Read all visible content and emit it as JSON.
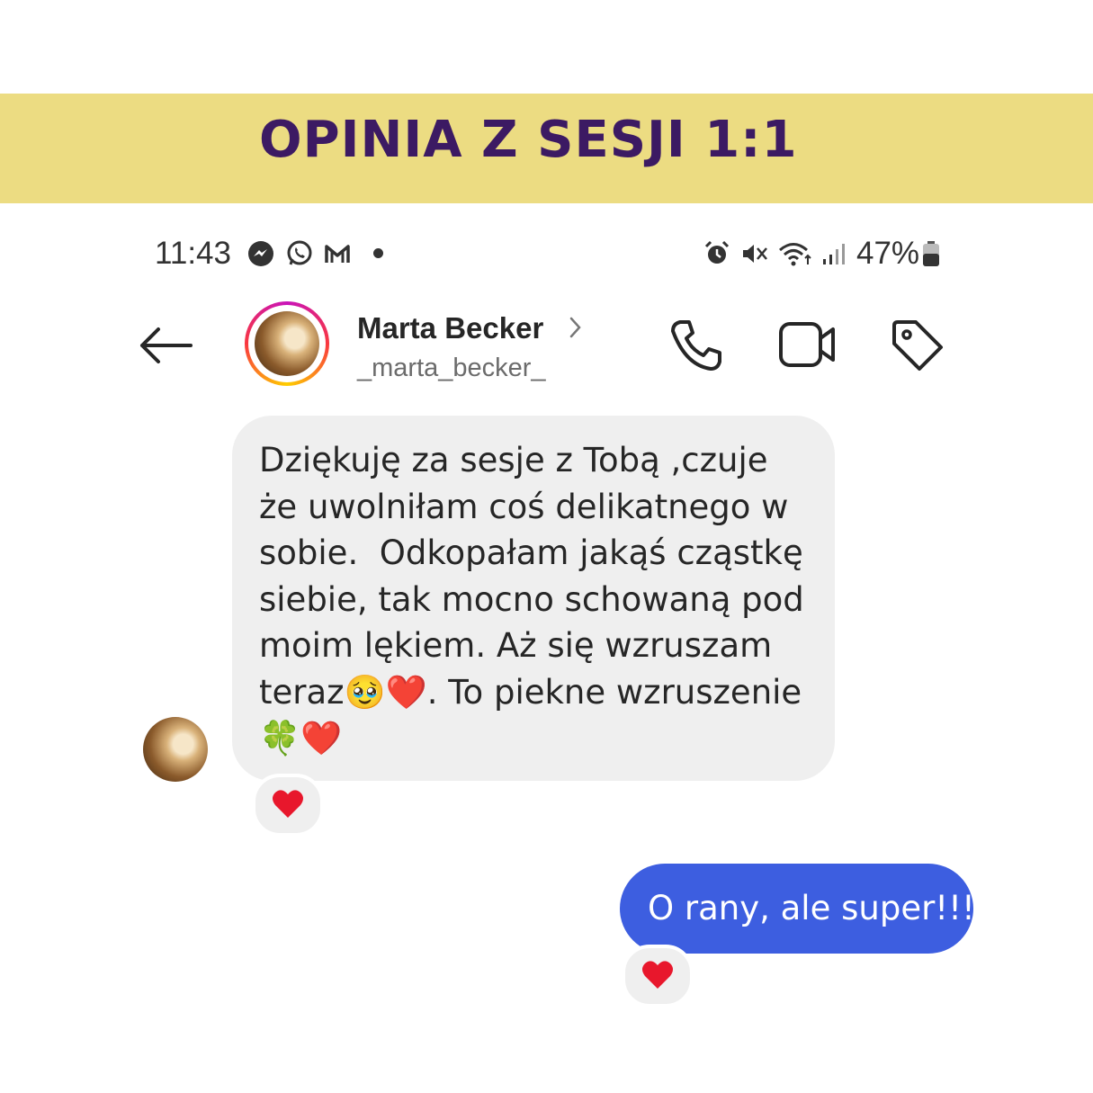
{
  "banner": {
    "title": "OPINIA Z SESJI 1:1"
  },
  "status_bar": {
    "time": "11:43",
    "left_icons": [
      "messenger-icon",
      "whatsapp-icon",
      "gmail-icon"
    ],
    "right_icons": [
      "alarm-icon",
      "mute-icon",
      "wifi-icon",
      "signal-icon",
      "battery-icon"
    ],
    "battery": "47%"
  },
  "header": {
    "name": "Marta Becker",
    "username": "_marta_becker_",
    "actions": [
      "back-arrow-icon",
      "phone-icon",
      "video-camera-icon",
      "tag-icon"
    ]
  },
  "messages": [
    {
      "direction": "incoming",
      "text": "Dziękuję za sesje z Tobą ,czuje\nże uwolniłam coś delikatnego w\nsobie.  Odkopałam jakąś cząstkę\nsiebie, tak mocno schowaną pod\nmoim lękiem. Aż się wzruszam\nteraz🥹❤️. To piekne wzruszenie\n🍀❤️",
      "reaction": "❤️"
    },
    {
      "direction": "outgoing",
      "text": "O rany, ale super!!!",
      "reaction": "❤️"
    }
  ],
  "colors": {
    "banner_bg": "#ecdc82",
    "banner_text": "#3c1a63",
    "incoming_bubble": "#efefef",
    "outgoing_bubble": "#3d5ee0",
    "heart": "#e8172c"
  }
}
